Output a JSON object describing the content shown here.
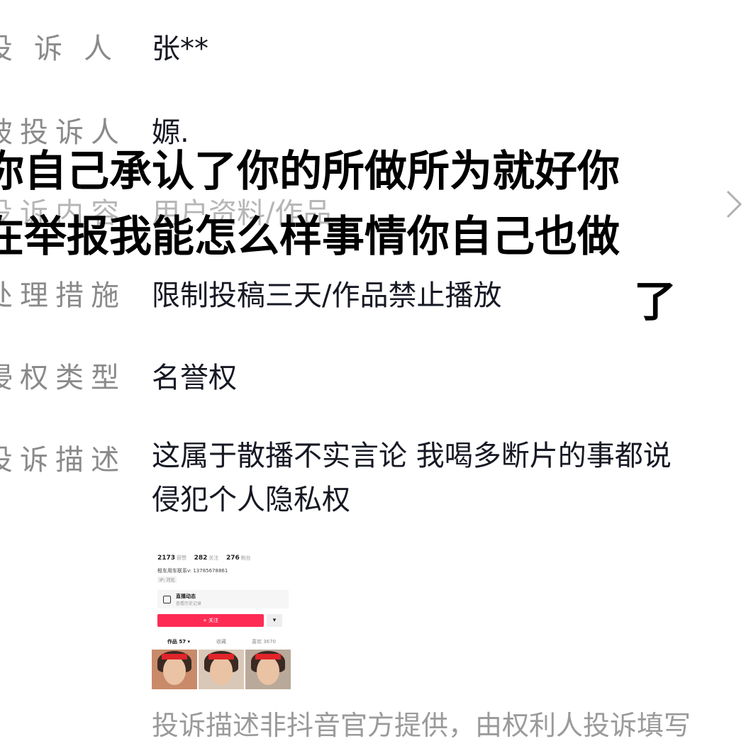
{
  "rows": [
    {
      "label": "投诉人",
      "value": "张**"
    },
    {
      "label": "被投诉人",
      "value": "嫄."
    },
    {
      "label": "投诉内容",
      "value": "用户资料/作品"
    },
    {
      "label": "处理措施",
      "value": "限制投稿三天/作品禁止播放"
    },
    {
      "label": "侵权类型",
      "value": "名誉权"
    },
    {
      "label": "投诉描述",
      "value": ""
    }
  ],
  "description": {
    "line1": "这属于散播不实言论 我喝多断片的事都说",
    "line2": "侵犯个人隐私权"
  },
  "overlay_text": {
    "line1": "你自己承认了你的所做所为就好你",
    "line2": "在举报我能怎么样事情你自己也做",
    "line3": "了"
  },
  "screenshot": {
    "likes_count": "2173",
    "likes_label": "获赞",
    "following_count": "282",
    "following_label": "关注",
    "followers_count": "276",
    "followers_label": "粉丝",
    "contact": "租车用车联系v: 13785678861",
    "ip": "IP: 河北",
    "live_title": "直播动态",
    "live_sub": "查看历史记录",
    "follow_button": "+ 关注",
    "tabs": [
      "作品 57 ▾",
      "收藏",
      "喜欢 3670"
    ]
  },
  "footer": "投诉描述非抖音官方提供，由权利人投诉填写",
  "icons": {
    "chevron": "chevron-right-icon"
  }
}
